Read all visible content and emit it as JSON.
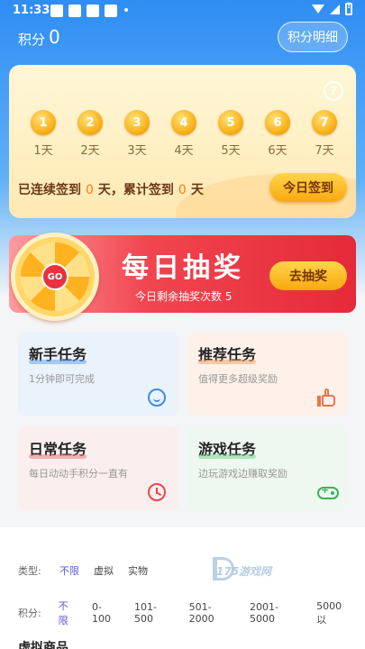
{
  "status_bar": {
    "time": "11:33"
  },
  "header": {
    "points_label": "积分",
    "points_value": "0",
    "detail_button": "积分明细"
  },
  "checkin": {
    "help_icon": "?",
    "days": [
      {
        "num": "1",
        "label": "1天"
      },
      {
        "num": "2",
        "label": "2天"
      },
      {
        "num": "3",
        "label": "3天"
      },
      {
        "num": "4",
        "label": "4天"
      },
      {
        "num": "5",
        "label": "5天"
      },
      {
        "num": "6",
        "label": "6天"
      },
      {
        "num": "7",
        "label": "7天"
      }
    ],
    "streak_prefix": "已连续签到",
    "streak_days": "0",
    "streak_mid": "天，累计签到",
    "total_days": "0",
    "streak_suffix": "天",
    "button": "今日签到"
  },
  "lottery": {
    "title": "每日抽奖",
    "remaining_text": "今日剩余抽奖次数 5",
    "button": "去抽奖",
    "wheel_center": "GO"
  },
  "tasks": {
    "newbie": {
      "title": "新手任务",
      "desc": "1分钟即可完成"
    },
    "recommend": {
      "title": "推荐任务",
      "desc": "值得更多超级奖励"
    },
    "daily": {
      "title": "日常任务",
      "desc": "每日动动手积分一直有"
    },
    "game": {
      "title": "游戏任务",
      "desc": "边玩游戏边赚取奖励"
    }
  },
  "filters": {
    "type": {
      "label": "类型:",
      "options": [
        "不限",
        "虚拟",
        "实物"
      ]
    },
    "points": {
      "label": "积分:",
      "options": [
        "不限",
        "0-100",
        "101-500",
        "501-2000",
        "2001-5000",
        "5000以"
      ]
    }
  },
  "watermark": "175游戏网",
  "section_title": "虚拟商品",
  "colors": {
    "accent_blue": "#2f8df3",
    "accent_orange": "#f9a80f",
    "active_filter": "#5b5bd6"
  }
}
